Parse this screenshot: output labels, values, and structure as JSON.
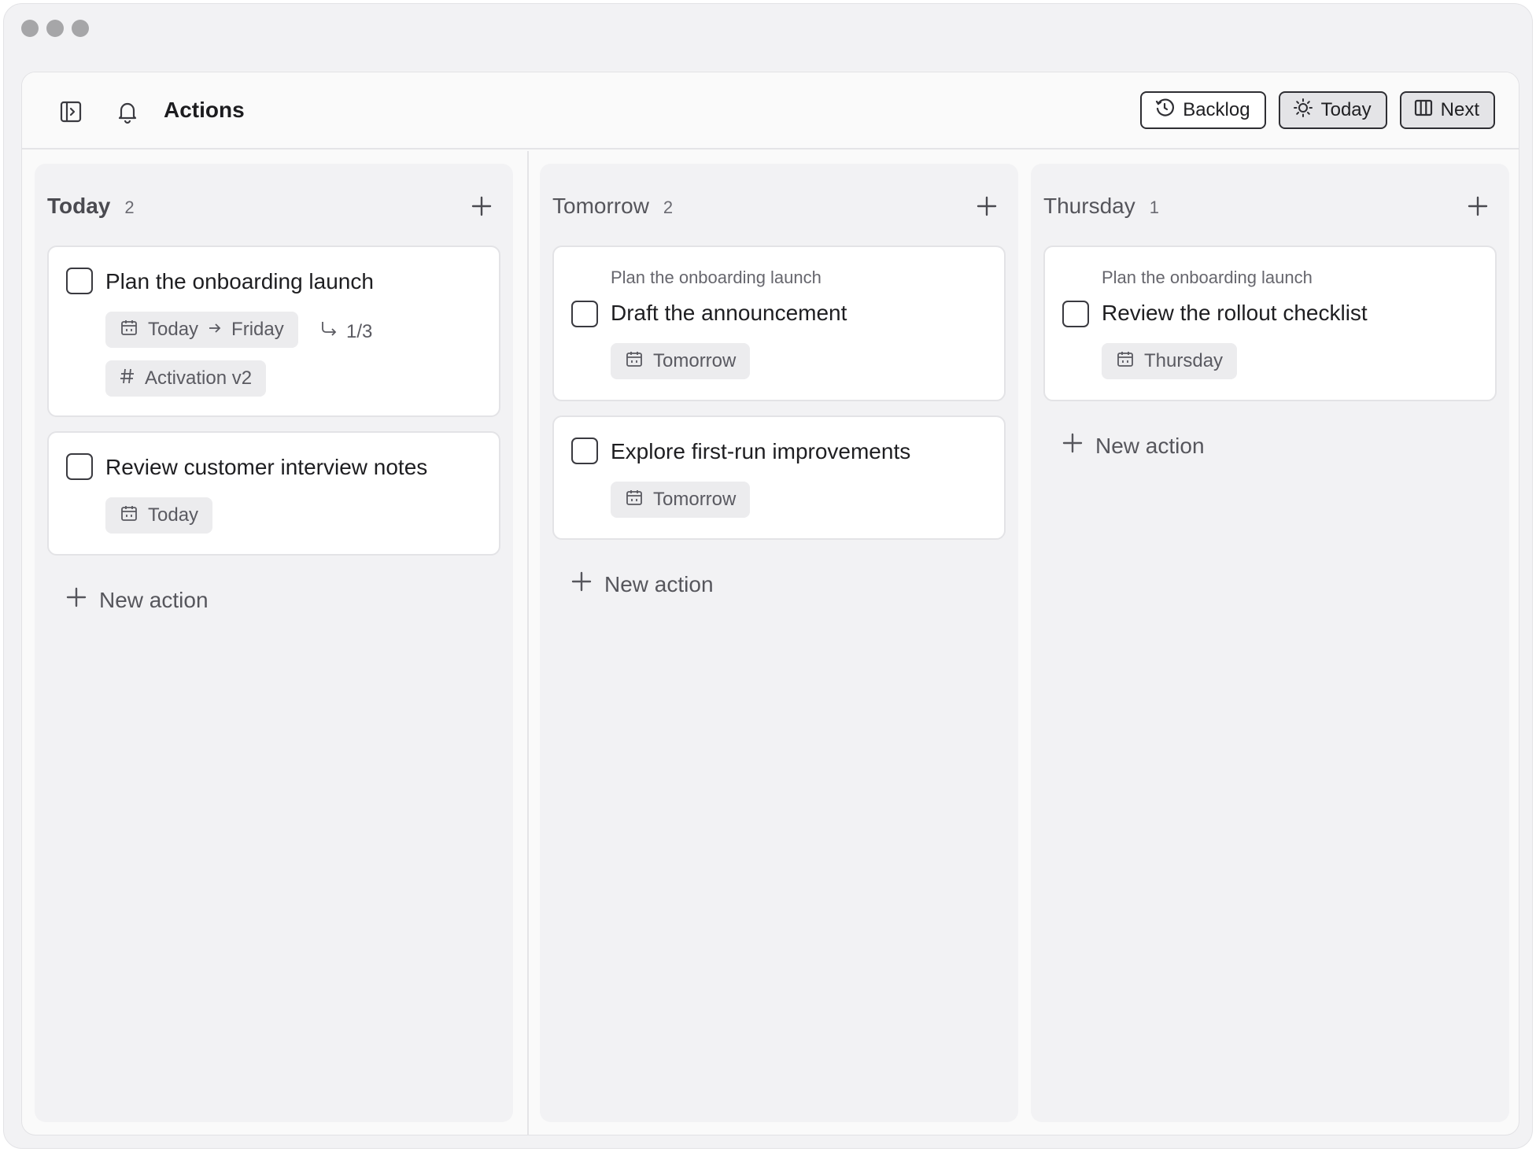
{
  "header": {
    "title": "Actions",
    "views": [
      {
        "label": "Backlog",
        "icon": "backlog-clock-icon",
        "active": false
      },
      {
        "label": "Today",
        "icon": "sun-icon",
        "active": true
      },
      {
        "label": "Next",
        "icon": "columns-icon",
        "active": true
      }
    ]
  },
  "columns": [
    {
      "title": "Today",
      "count": "2",
      "cards": [
        {
          "title": "Plan the onboarding launch",
          "date_start": "Today",
          "date_end": "Friday",
          "subtasks": "1/3",
          "tag": "Activation v2"
        },
        {
          "title": "Review customer interview notes",
          "date": "Today"
        }
      ],
      "new_action": "New action"
    },
    {
      "title": "Tomorrow",
      "count": "2",
      "cards": [
        {
          "parent": "Plan the onboarding launch",
          "title": "Draft the announcement",
          "date": "Tomorrow"
        },
        {
          "title": "Explore first-run improvements",
          "date": "Tomorrow"
        }
      ],
      "new_action": "New action"
    },
    {
      "title": "Thursday",
      "count": "1",
      "cards": [
        {
          "parent": "Plan the onboarding launch",
          "title": "Review the rollout checklist",
          "date": "Thursday"
        }
      ],
      "new_action": "New action"
    }
  ],
  "colors": {
    "accent_border": "#2e2e33",
    "column_bg": "#f2f2f4",
    "card_bg": "#ffffff"
  }
}
